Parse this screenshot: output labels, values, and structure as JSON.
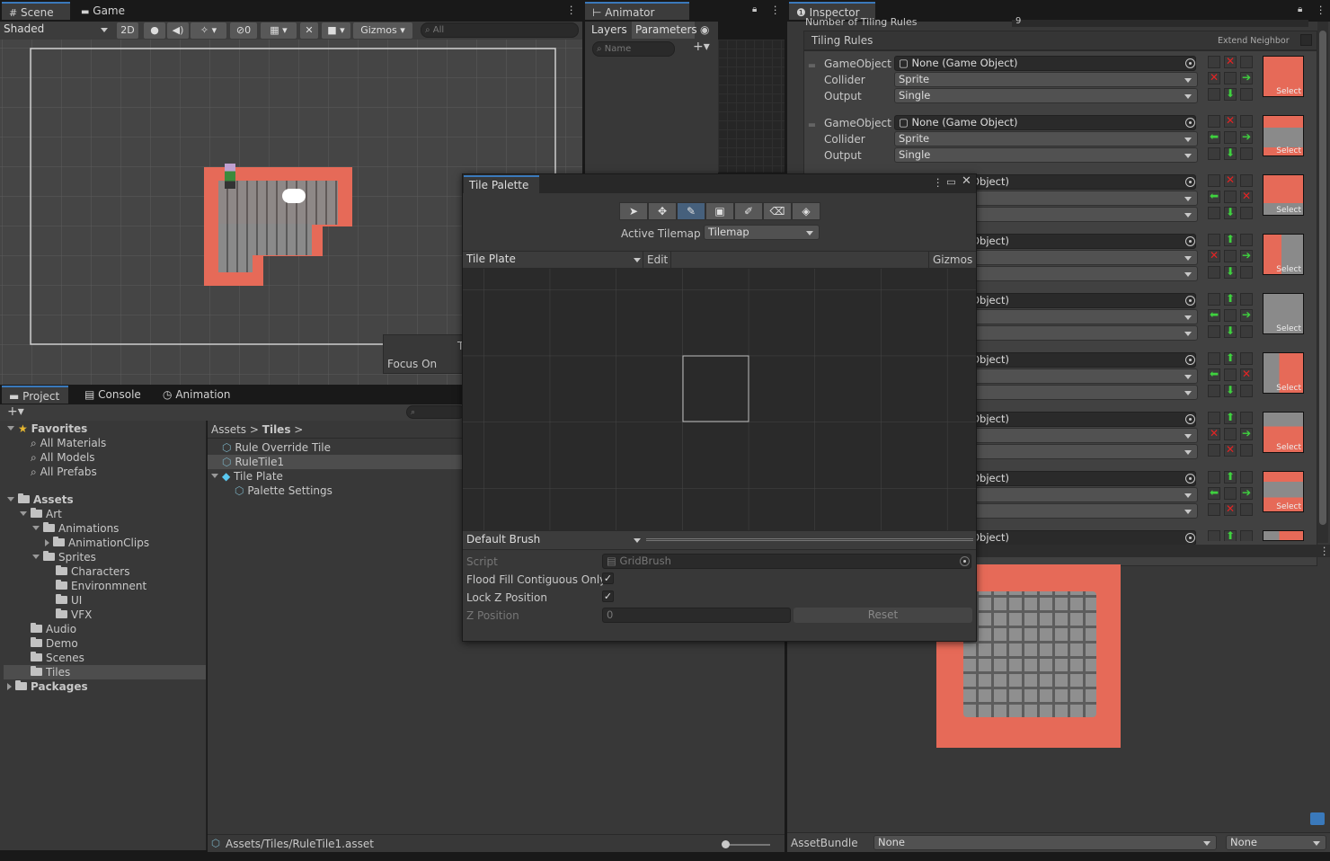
{
  "scene": {
    "tabs": [
      "Scene",
      "Game"
    ],
    "shading": "Shaded",
    "toggle_2d": "2D",
    "hidden_count": "0",
    "gizmos": "Gizmos",
    "search_placeholder": "All",
    "focus_label": "Focus On",
    "overflow_char": "T"
  },
  "animator": {
    "tab": "Animator",
    "layers_tab": "Layers",
    "parameters_tab": "Parameters",
    "search_placeholder": "Name"
  },
  "inspector": {
    "tab": "Inspector",
    "truncated_header": "Number of Tiling Rules",
    "truncated_value": "9",
    "section_title": "Tiling Rules",
    "extend_neighbor": "Extend Neighbor",
    "rules": [
      {
        "gameobject_label": "GameObject",
        "gameobject_value": "None (Game Object)",
        "collider_label": "Collider",
        "collider_value": "Sprite",
        "output_label": "Output",
        "output_value": "Single",
        "select": "Select"
      },
      {
        "gameobject_label": "GameObject",
        "gameobject_value": "None (Game Object)",
        "collider_label": "Collider",
        "collider_value": "Sprite",
        "output_label": "Output",
        "output_value": "Single",
        "select": "Select"
      }
    ],
    "partial_object_text": "Object)",
    "select_label": "Select",
    "assetbundle_label": "AssetBundle",
    "assetbundle_value": "None",
    "assetbundle_variant": "None"
  },
  "palette": {
    "title": "Tile Palette",
    "active_tilemap_label": "Active Tilemap",
    "active_tilemap_value": "Tilemap",
    "palette_value": "Tile Plate",
    "edit": "Edit",
    "gizmos": "Gizmos",
    "brush": "Default Brush",
    "script_label": "Script",
    "script_value": "GridBrush",
    "flood_fill_label": "Flood Fill Contiguous Only",
    "lock_z_label": "Lock Z Position",
    "z_position_label": "Z Position",
    "z_position_value": "0",
    "reset": "Reset"
  },
  "project": {
    "tabs": [
      "Project",
      "Console",
      "Animation"
    ],
    "favorites": "Favorites",
    "favorite_items": [
      "All Materials",
      "All Models",
      "All Prefabs"
    ],
    "assets": "Assets",
    "tree": {
      "art": "Art",
      "animations": "Animations",
      "animation_clips": "AnimationClips",
      "sprites": "Sprites",
      "characters": "Characters",
      "environment": "Environmnent",
      "ui": "UI",
      "vfx": "VFX",
      "audio": "Audio",
      "demo": "Demo",
      "scenes": "Scenes",
      "tiles": "Tiles",
      "packages": "Packages"
    },
    "breadcrumb": [
      "Assets",
      "Tiles"
    ],
    "files": [
      "Rule Override Tile",
      "RuleTile1",
      "Tile Plate",
      "Palette Settings"
    ],
    "status_path": "Assets/Tiles/RuleTile1.asset"
  },
  "colors": {
    "accent": "#3a79bb",
    "panel": "#383838",
    "tile_red": "#e66a58",
    "arrow_green": "#3fd13f",
    "x_red": "#e32424"
  }
}
